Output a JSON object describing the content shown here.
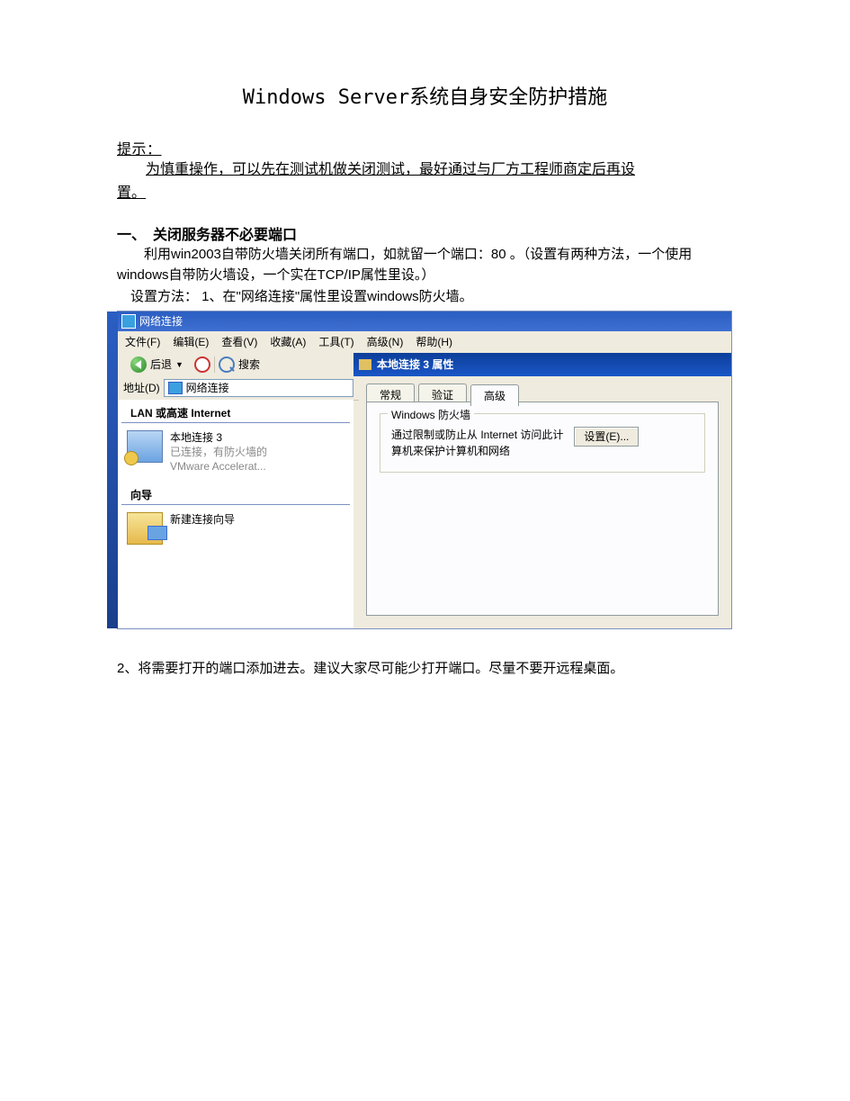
{
  "doc": {
    "title": "Windows Server系统自身安全防护措施",
    "hint_label": "提示：",
    "hint_body_line1": "为慎重操作，可以先在测试机做关闭测试，最好通过与厂方工程师商定后再设",
    "hint_body_line2": "置。",
    "section1_head": "一、　关闭服务器不必要端口",
    "section1_p1": "　　利用win2003自带防火墙关闭所有端口，如就留一个端口：80 。（设置有两种方法，一个使用windows自带防火墙设，一个实在TCP/IP属性里设。）",
    "section1_p2": "　设置方法：  1、在\"网络连接\"属性里设置windows防火墙。",
    "step2": "2、将需要打开的端口添加进去。建议大家尽可能少打开端口。尽量不要开远程桌面。"
  },
  "win": {
    "title": "网络连接",
    "menu": {
      "file": "文件(F)",
      "edit": "编辑(E)",
      "view": "查看(V)",
      "fav": "收藏(A)",
      "tools": "工具(T)",
      "adv": "高级(N)",
      "help": "帮助(H)"
    },
    "toolbar": {
      "back": "后退",
      "search": "搜索"
    },
    "address_label": "地址(D)",
    "address_value": "网络连接",
    "groups": {
      "lan": "LAN 或高速 Internet",
      "wizard": "向导"
    },
    "conn_item": {
      "name": "本地连接 3",
      "status": "已连接，有防火墙的",
      "adapter": "VMware Accelerat..."
    },
    "wizard_item": "新建连接向导",
    "props_title": "本地连接 3 属性",
    "tabs": {
      "general": "常规",
      "auth": "验证",
      "advanced": "高级"
    },
    "group_legend": "Windows 防火墙",
    "group_text_l1": "通过限制或防止从 Internet 访问此计",
    "group_text_l2": "算机来保护计算机和网络",
    "settings_btn": "设置(E)..."
  }
}
